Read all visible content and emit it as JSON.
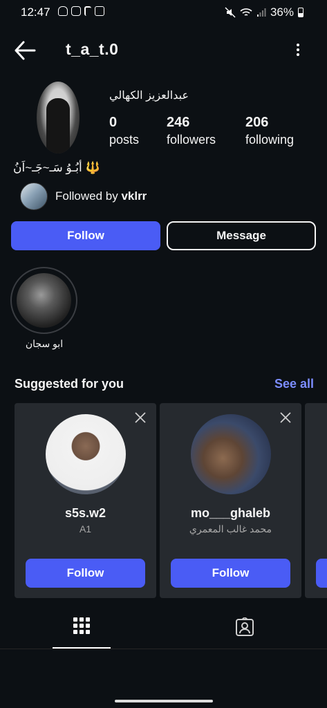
{
  "status_bar": {
    "time": "12:47",
    "battery": "36%"
  },
  "header": {
    "username": "t_a_t.0"
  },
  "profile": {
    "display_name": "عبدالعزيز  الكهالي",
    "stats": [
      {
        "value": "0",
        "label": "posts"
      },
      {
        "value": "246",
        "label": "followers"
      },
      {
        "value": "206",
        "label": "following"
      }
    ],
    "bio": "أبُـوُ سَـ~جَـ~اَنُ",
    "bio_emoji": "🔱",
    "followed_by_prefix": "Followed by ",
    "followed_by_user": "vklrr"
  },
  "actions": {
    "follow_label": "Follow",
    "message_label": "Message"
  },
  "highlight": {
    "label": "ابو سجان"
  },
  "suggested": {
    "title": "Suggested for you",
    "see_all": "See all",
    "cards": [
      {
        "username": "s5s.w2",
        "subtitle": "A1",
        "button": "Follow"
      },
      {
        "username": "mo___ghaleb",
        "subtitle": "محمد غالب المعمري",
        "button": "Follow"
      }
    ]
  },
  "colors": {
    "accent": "#4a5cf5",
    "link": "#7c8dff",
    "background": "#0c1014",
    "card": "#262a2f"
  }
}
